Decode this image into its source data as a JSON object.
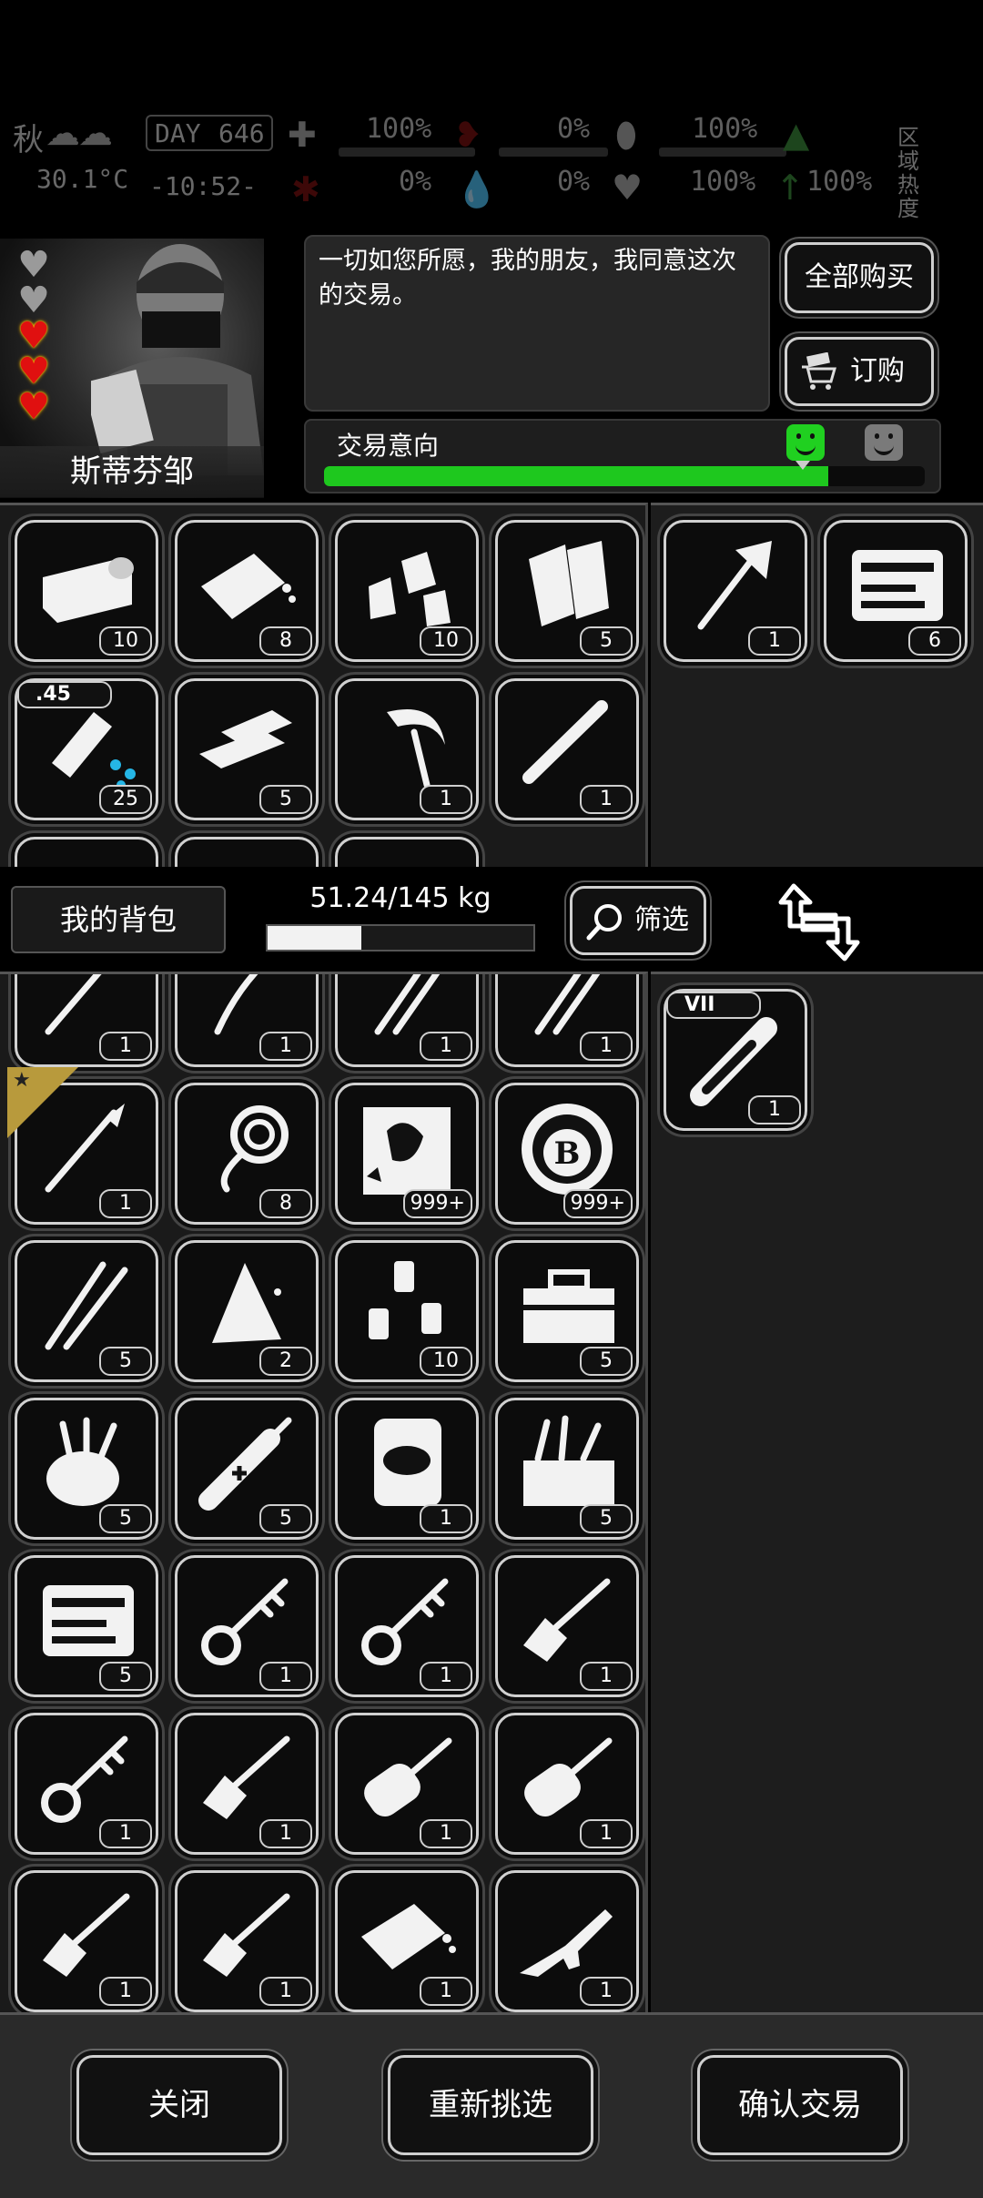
{
  "hud": {
    "season": "秋",
    "day_label": "DAY",
    "day": "646",
    "temperature": "30.1°C",
    "time": "-10:52-",
    "stats_top": [
      "100%",
      "0%",
      "100%"
    ],
    "stats_bottom": [
      "0%",
      "0%",
      "100%",
      "100%"
    ],
    "zone_heat": "区域热度"
  },
  "trader": {
    "name": "斯蒂芬邹",
    "hearts": [
      "empty",
      "empty",
      "full",
      "full",
      "full"
    ],
    "dialog": "一切如您所愿，我的朋友，我同意这次的交易。",
    "buy_all": "全部购买",
    "order": "订购",
    "intent_label": "交易意向",
    "intent_level": 0.84
  },
  "trader_inventory": [
    {
      "icon": "canned-food-icon",
      "qty": "10"
    },
    {
      "icon": "chocolate-bar-icon",
      "qty": "8"
    },
    {
      "icon": "food-pouches-icon",
      "qty": "10"
    },
    {
      "icon": "cloth-rolls-icon",
      "qty": "5"
    },
    {
      "icon": "water-bottle-icon",
      "qty": "25",
      "tag": ".45"
    },
    {
      "icon": "metal-ingots-icon",
      "qty": "5"
    },
    {
      "icon": "sickle-icon",
      "qty": "1"
    },
    {
      "icon": "metal-pipe-icon",
      "qty": "1"
    }
  ],
  "trader_offer": [
    {
      "icon": "fire-axe-icon",
      "qty": "1"
    },
    {
      "icon": "tool-case-icon",
      "qty": "6"
    }
  ],
  "bag": {
    "title": "我的背包",
    "weight": "51.24/145 kg",
    "weight_fill": 0.353,
    "filter": "筛选"
  },
  "my_inventory": [
    {
      "icon": "scalpel-icon",
      "qty": "1"
    },
    {
      "icon": "crowbar-icon",
      "qty": "1"
    },
    {
      "icon": "twin-blades-icon",
      "qty": "1"
    },
    {
      "icon": "twin-blades-icon",
      "qty": "1"
    },
    {
      "icon": "scalpel-icon",
      "qty": "1",
      "star": true
    },
    {
      "icon": "rope-coil-icon",
      "qty": "8"
    },
    {
      "icon": "stamp-card-icon",
      "qty": "999+"
    },
    {
      "icon": "bitcoin-token-icon",
      "qty": "999+"
    },
    {
      "icon": "lock-picks-icon",
      "qty": "5"
    },
    {
      "icon": "cloth-scrap-icon",
      "qty": "2"
    },
    {
      "icon": "pill-bottles-icon",
      "qty": "10"
    },
    {
      "icon": "toolbox-icon",
      "qty": "5"
    },
    {
      "icon": "tool-pouch-icon",
      "qty": "5"
    },
    {
      "icon": "syringe-icon",
      "qty": "5"
    },
    {
      "icon": "food-can-icon",
      "qty": "1"
    },
    {
      "icon": "open-toolbox-icon",
      "qty": "5"
    },
    {
      "icon": "tool-case-icon",
      "qty": "5"
    },
    {
      "icon": "key-icon",
      "qty": "1"
    },
    {
      "icon": "key-icon",
      "qty": "1"
    },
    {
      "icon": "car-key-icon",
      "qty": "1"
    },
    {
      "icon": "key-icon",
      "qty": "1"
    },
    {
      "icon": "car-key-icon",
      "qty": "1"
    },
    {
      "icon": "remote-key-icon",
      "qty": "1"
    },
    {
      "icon": "remote-key-icon",
      "qty": "1"
    },
    {
      "icon": "car-key-icon",
      "qty": "1"
    },
    {
      "icon": "car-key-icon",
      "qty": "1"
    },
    {
      "icon": "chocolate-bar-icon",
      "qty": "1"
    },
    {
      "icon": "rifle-icon",
      "qty": "1"
    }
  ],
  "my_offer": [
    {
      "icon": "test-tube-icon",
      "qty": "1",
      "tag": "VII"
    }
  ],
  "actions": {
    "close": "关闭",
    "reselect": "重新挑选",
    "confirm": "确认交易"
  }
}
